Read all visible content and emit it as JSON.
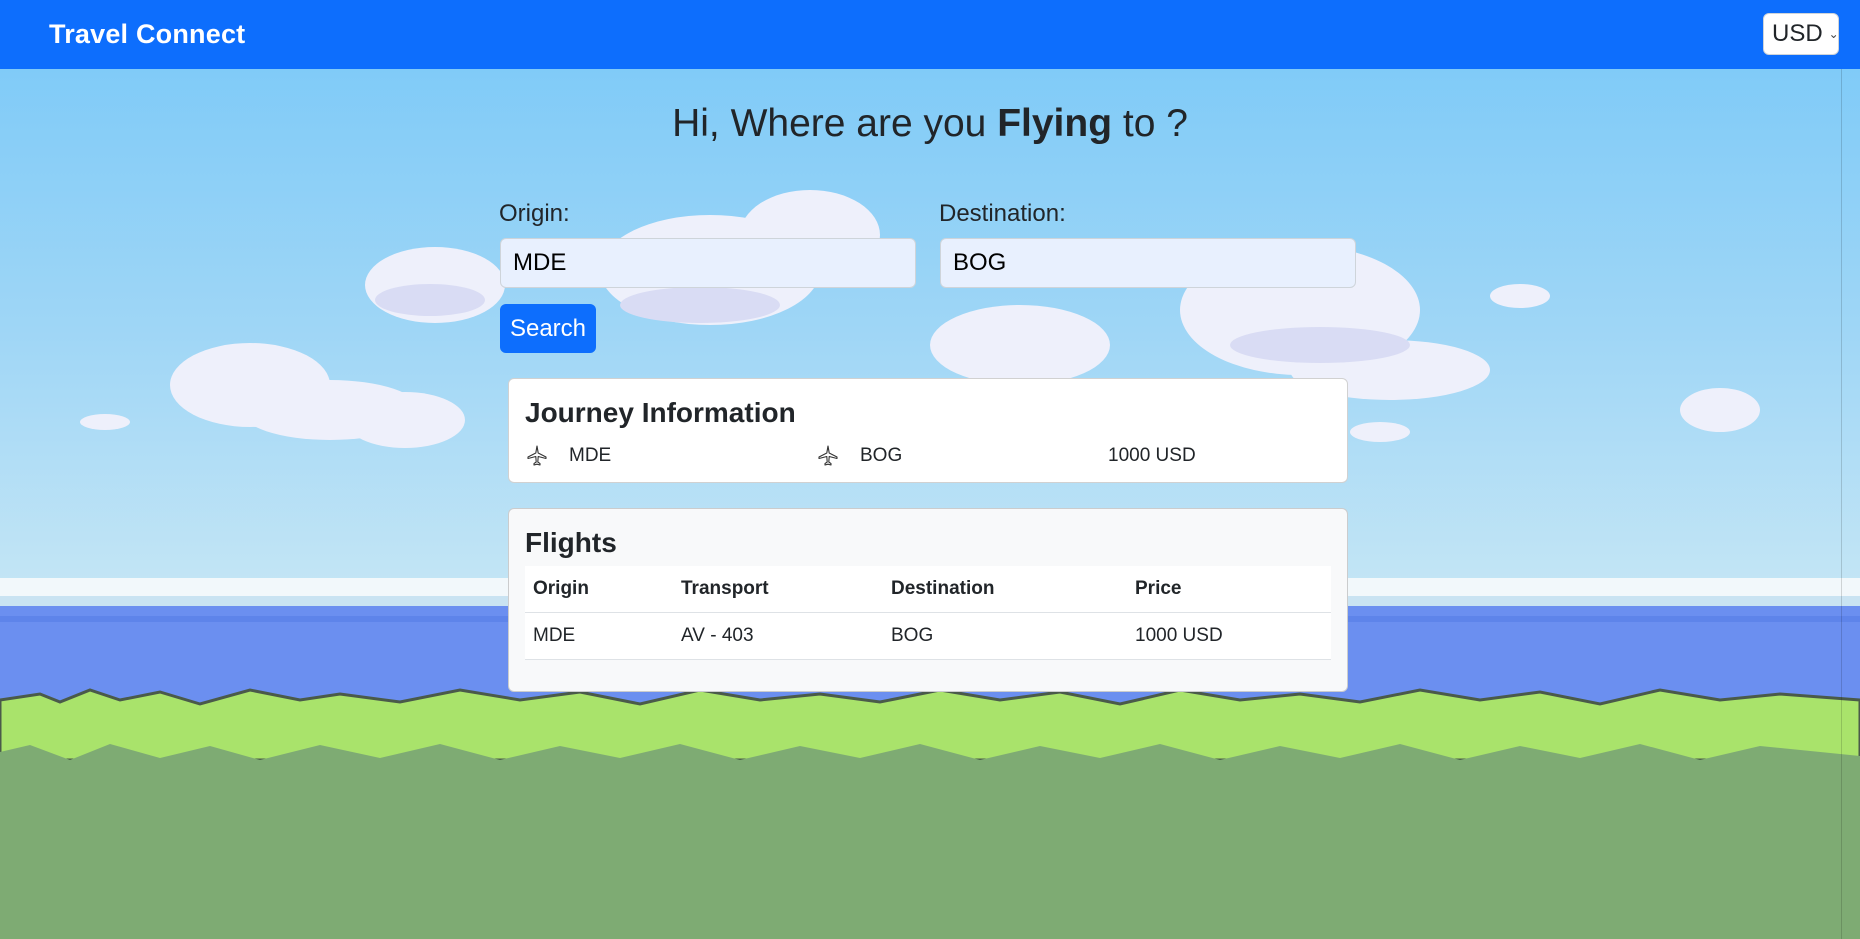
{
  "navbar": {
    "brand": "Travel Connect",
    "currency": "USD",
    "currency_icon": "chevron-down-icon"
  },
  "hero": {
    "greeting_pre": "Hi, Where are you ",
    "greeting_bold": "Flying",
    "greeting_post": " to ?"
  },
  "form": {
    "origin_label": "Origin:",
    "origin_value": "MDE",
    "destination_label": "Destination:",
    "destination_value": "BOG",
    "search_label": "Search"
  },
  "journey": {
    "title": "Journey Information",
    "origin": "MDE",
    "destination": "BOG",
    "price": "1000 USD",
    "icon": "airplane-icon"
  },
  "flights": {
    "title": "Flights",
    "columns": [
      "Origin",
      "Transport",
      "Destination",
      "Price"
    ],
    "rows": [
      [
        "MDE",
        "AV - 403",
        "BOG",
        "1000 USD"
      ]
    ]
  },
  "colors": {
    "primary": "#0d6efd",
    "sky": "#7ac9f7",
    "sea": "#6b8ff0",
    "grass": "#a9e36b",
    "ground": "#7eab73"
  }
}
